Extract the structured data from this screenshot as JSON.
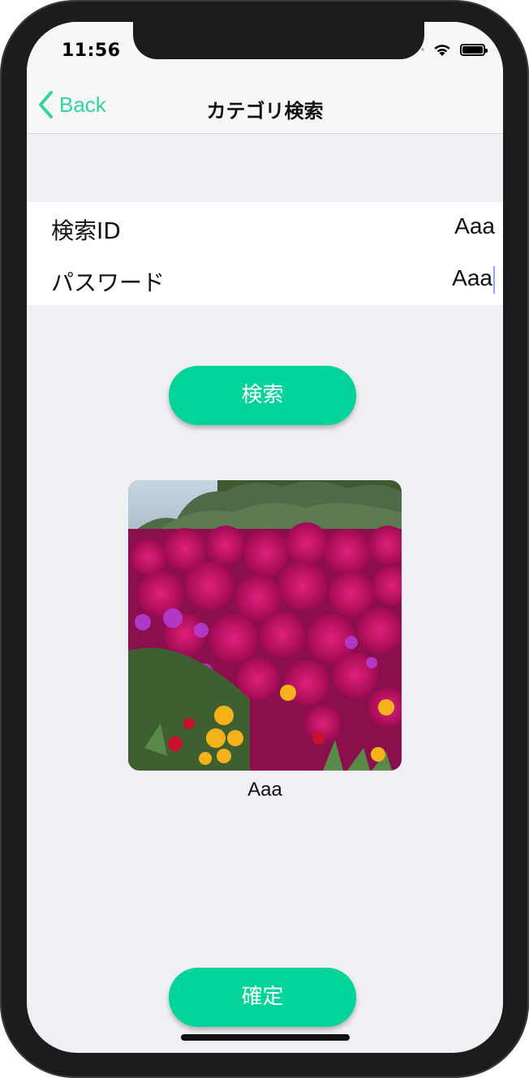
{
  "status": {
    "time": "11:56",
    "icons": [
      "signal-icon",
      "wifi-icon",
      "battery-icon"
    ]
  },
  "nav": {
    "back_label": "Back",
    "back_icon": "chevron-left-icon",
    "title": "カテゴリ検索"
  },
  "form": {
    "rows": [
      {
        "label": "検索ID",
        "value": "Aaa"
      },
      {
        "label": "パスワード",
        "value": "Aaa"
      }
    ]
  },
  "buttons": {
    "search_label": "検索",
    "confirm_label": "確定"
  },
  "photo": {
    "caption": "Aaa",
    "subject": "flower-field-image"
  },
  "colors": {
    "accent": "#2ed4a1",
    "button": "#00d498",
    "background": "#efeff4"
  }
}
